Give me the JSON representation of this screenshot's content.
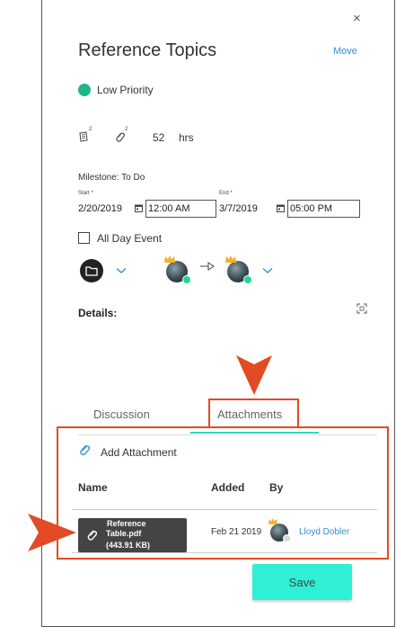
{
  "dialog": {
    "close_glyph": "×",
    "title": "Reference Topics",
    "move_label": "Move"
  },
  "priority": {
    "label": "Low Priority",
    "color": "#1fb58a"
  },
  "meta": {
    "doc_count": "2",
    "attachment_count": "2",
    "hours_value": "52",
    "hours_unit": "hrs"
  },
  "milestone": {
    "label": "Milestone: To Do"
  },
  "schedule": {
    "start_label": "Start *",
    "start_date": "2/20/2019",
    "start_time": "12:00 AM",
    "end_label": "End *",
    "end_date": "3/7/2019",
    "end_time": "05:00 PM"
  },
  "all_day": {
    "label": "All Day Event",
    "checked": false
  },
  "details": {
    "label": "Details:"
  },
  "tabs": [
    {
      "label": "Discussion",
      "active": false
    },
    {
      "label": "Attachments",
      "active": true
    }
  ],
  "attachments": {
    "add_label": "Add Attachment",
    "columns": [
      "Name",
      "Added",
      "By"
    ],
    "rows": [
      {
        "name_line1": "Reference",
        "name_line2": "Table.pdf",
        "size": "(443.91 KB)",
        "added": "Feb 21 2019",
        "by": "Lloyd Dobler"
      }
    ]
  },
  "save_label": "Save",
  "colors": {
    "accent_teal": "#2ff0d5",
    "link_blue": "#2f8ecf",
    "annotation_orange": "#e24b23",
    "status_green": "#22d39a"
  },
  "icons": [
    "close-icon",
    "document-icon",
    "paperclip-icon",
    "calendar-icon",
    "folder-icon",
    "chevron-down-icon",
    "arrow-right-icon",
    "expand-icon",
    "crown-icon"
  ]
}
